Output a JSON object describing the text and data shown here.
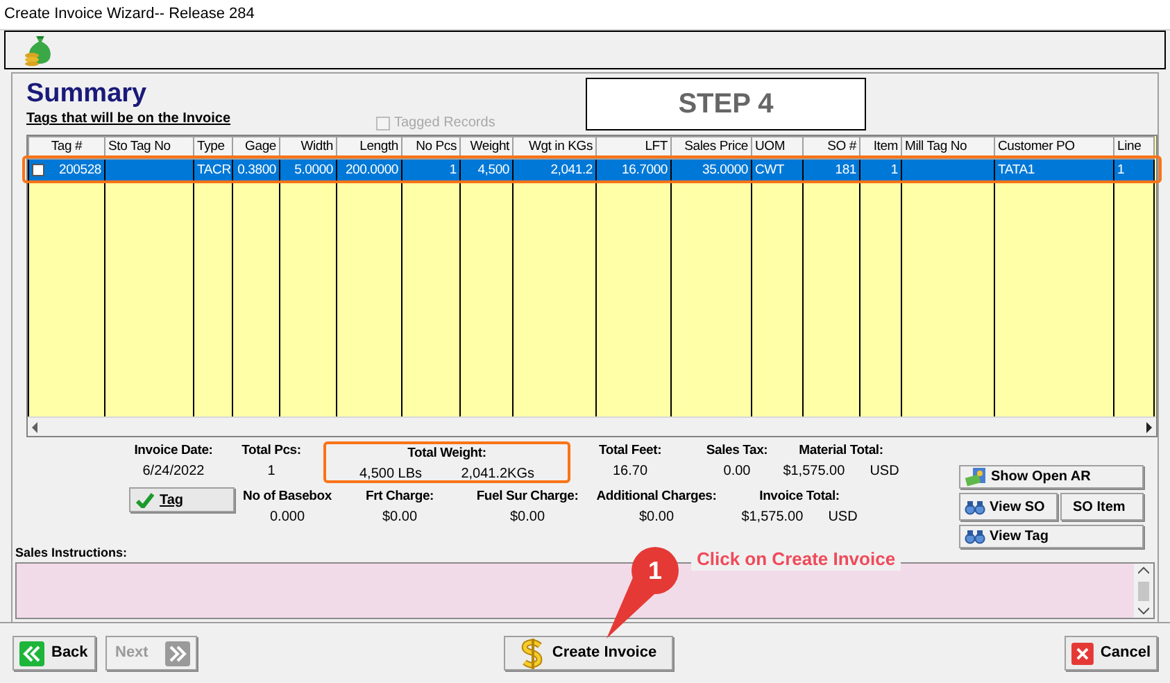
{
  "window": {
    "title": "Create Invoice Wizard-- Release  284"
  },
  "heading": "Summary",
  "subheading": "Tags that will be on the Invoice",
  "tagged_records": {
    "label": "Tagged Records",
    "checked": false,
    "disabled": true
  },
  "step": "STEP 4",
  "table": {
    "columns": [
      "Tag #",
      "Sto Tag No",
      "Type",
      "Gage",
      "Width",
      "Length",
      "No Pcs",
      "Weight",
      "Wgt in KGs",
      "LFT",
      "Sales Price",
      "UOM",
      "SO #",
      "Item",
      "Mill Tag No",
      "Customer PO",
      "Line"
    ],
    "rows": [
      {
        "checked": false,
        "selected": true,
        "cells": [
          "200528",
          "",
          "TACR",
          "0.3800",
          "5.0000",
          "200.0000",
          "1",
          "4,500",
          "2,041.2",
          "16.7000",
          "35.0000",
          "CWT",
          "181",
          "1",
          "",
          "TATA1",
          "1"
        ]
      }
    ]
  },
  "summary_top": [
    {
      "label": "Invoice Date:",
      "values": [
        "6/24/2022"
      ]
    },
    {
      "label": "Total Pcs:",
      "values": [
        "1"
      ]
    },
    {
      "label": "Total Weight:",
      "values": [
        "4,500 LBs",
        "2,041.2KGs"
      ]
    },
    {
      "label": "Total Feet:",
      "values": [
        "16.70"
      ]
    },
    {
      "label": "Sales Tax:",
      "values": [
        "0.00"
      ]
    },
    {
      "label": "Material Total:",
      "values": [
        "$1,575.00",
        "USD"
      ]
    }
  ],
  "tag_button": "Tag",
  "summary_bottom": [
    {
      "label": "No of Basebox",
      "values": [
        "0.000"
      ]
    },
    {
      "label": "Frt Charge:",
      "values": [
        "$0.00"
      ]
    },
    {
      "label": "Fuel Sur Charge:",
      "values": [
        "$0.00"
      ]
    },
    {
      "label": "Additional Charges:",
      "values": [
        "$0.00"
      ]
    },
    {
      "label": "Invoice Total:",
      "values": [
        "$1,575.00",
        "USD"
      ]
    }
  ],
  "side_buttons": [
    {
      "label": "Show Open AR",
      "kind": "ar"
    },
    {
      "label": "View SO",
      "kind": "view"
    },
    {
      "label": "SO Item",
      "kind": "plain"
    },
    {
      "label": "View Tag",
      "kind": "view"
    }
  ],
  "sales_instructions": {
    "label": "Sales Instructions:"
  },
  "footer_buttons": [
    {
      "label": "Back",
      "kind": "back",
      "disabled": false
    },
    {
      "label": "Next",
      "kind": "next",
      "disabled": true
    },
    {
      "label": "Create Invoice",
      "kind": "create",
      "disabled": false
    },
    {
      "label": "Cancel",
      "kind": "cancel",
      "disabled": false
    }
  ],
  "annotation": {
    "number": "1",
    "text": "Click on Create Invoice"
  }
}
